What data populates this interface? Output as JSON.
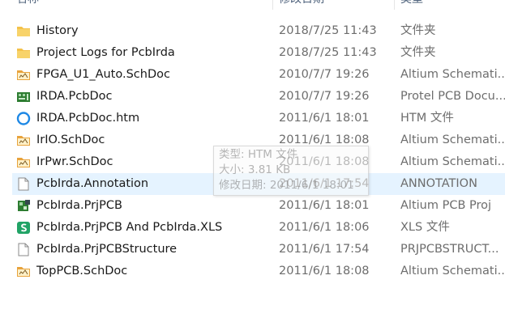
{
  "header": {
    "name": "名称",
    "date": "修改日期",
    "type": "类型"
  },
  "files": [
    {
      "name": "History",
      "date": "2018/7/25 11:43",
      "type": "文件夹",
      "icon": "folder-icon"
    },
    {
      "name": "Project Logs for PcbIrda",
      "date": "2018/7/25 11:43",
      "type": "文件夹",
      "icon": "folder-icon"
    },
    {
      "name": "FPGA_U1_Auto.SchDoc",
      "date": "2010/7/7 19:26",
      "type": "Altium Schemati...",
      "icon": "schdoc-icon"
    },
    {
      "name": "IRDA.PcbDoc",
      "date": "2010/7/7 19:26",
      "type": "Protel PCB Docu...",
      "icon": "pcbdoc-icon"
    },
    {
      "name": "IRDA.PcbDoc.htm",
      "date": "2011/6/1 18:01",
      "type": "HTM 文件",
      "icon": "browser-icon"
    },
    {
      "name": "IrIO.SchDoc",
      "date": "2011/6/1 18:08",
      "type": "Altium Schemati...",
      "icon": "schdoc-icon"
    },
    {
      "name": "IrPwr.SchDoc",
      "date": "2011/6/1 18:08",
      "type": "Altium Schemati...",
      "icon": "schdoc-icon"
    },
    {
      "name": "PcbIrda.Annotation",
      "date": "2011/6/1 17:54",
      "type": "ANNOTATION",
      "icon": "blank-file-icon"
    },
    {
      "name": "PcbIrda.PrjPCB",
      "date": "2011/6/1 18:01",
      "type": "Altium PCB Proj",
      "icon": "prjpcb-icon"
    },
    {
      "name": "PcbIrda.PrjPCB And PcbIrda.XLS",
      "date": "2011/6/1 18:06",
      "type": "XLS 文件",
      "icon": "spreadsheet-icon"
    },
    {
      "name": "PcbIrda.PrjPCBStructure",
      "date": "2011/6/1 17:54",
      "type": "PRJPCBSTRUCT...",
      "icon": "blank-file-icon"
    },
    {
      "name": "TopPCB.SchDoc",
      "date": "2011/6/1 18:08",
      "type": "Altium Schemati...",
      "icon": "schdoc-icon"
    }
  ],
  "selected_index": 7,
  "tooltip": {
    "type_line": "类型: HTM 文件",
    "size_line": "大小: 3.81 KB",
    "date_line": "修改日期: 2011/6/1 18:01"
  },
  "colors": {
    "selection": "#e5f3ff",
    "folder": "#f4c14a",
    "schdoc": "#e8a33c",
    "pcb": "#2e7d32",
    "browser": "#1e88e5",
    "spreadsheet": "#21a366"
  }
}
